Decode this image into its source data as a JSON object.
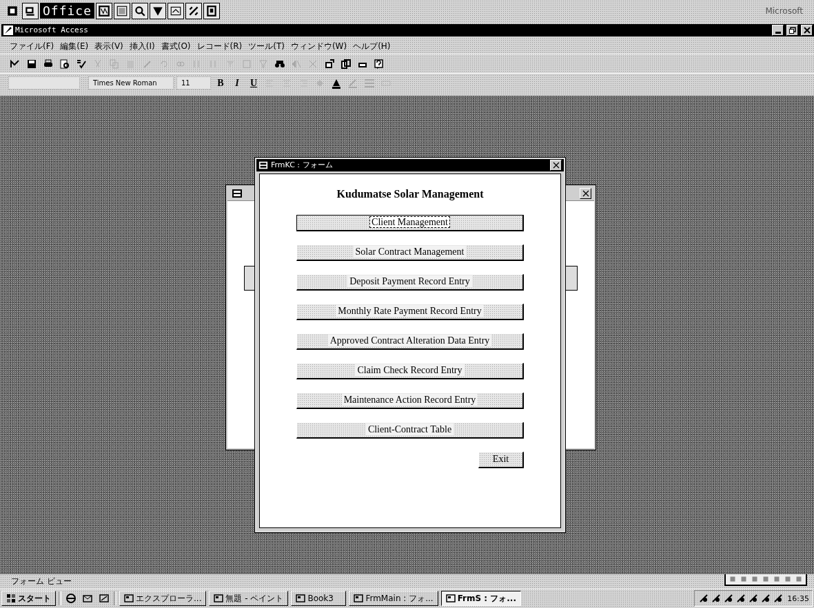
{
  "office_bar": {
    "title": "Office",
    "right_label": "Microsoft"
  },
  "window": {
    "title": "Microsoft Access"
  },
  "menu": [
    "ファイル(F)",
    "編集(E)",
    "表示(V)",
    "挿入(I)",
    "書式(O)",
    "レコード(R)",
    "ツール(T)",
    "ウィンドウ(W)",
    "ヘルプ(H)"
  ],
  "format_toolbar": {
    "font": "Times New Roman",
    "size": "11",
    "bold": "B",
    "italic": "I",
    "underline": "U"
  },
  "dialog": {
    "title": "FrmKC : フォーム",
    "heading": "Kudumatse Solar Management",
    "buttons": [
      {
        "label": "Client Management",
        "focused": true
      },
      {
        "label": "Solar Contract Management",
        "focused": false
      },
      {
        "label": "Deposit Payment Record Entry",
        "focused": false
      },
      {
        "label": "Monthly Rate Payment Record Entry",
        "focused": false
      },
      {
        "label": "Approved Contract Alteration Data Entry",
        "focused": false
      },
      {
        "label": "Claim Check Record Entry",
        "focused": false
      },
      {
        "label": "Maintenance Action Record Entry",
        "focused": false
      },
      {
        "label": "Client-Contract Table",
        "focused": false
      }
    ],
    "exit": {
      "label": "Exit"
    }
  },
  "status_bar": {
    "text": "フォーム ビュー"
  },
  "taskbar": {
    "start": "スタート",
    "tasks": [
      {
        "label": "エクスプローラ...",
        "selected": false
      },
      {
        "label": "無題 - ペイント",
        "selected": false
      },
      {
        "label": "Book3",
        "selected": false
      },
      {
        "label": "FrmMain : フォ...",
        "selected": false
      },
      {
        "label": "FrmS : フォ...",
        "selected": true
      }
    ],
    "clock": "16:35"
  }
}
